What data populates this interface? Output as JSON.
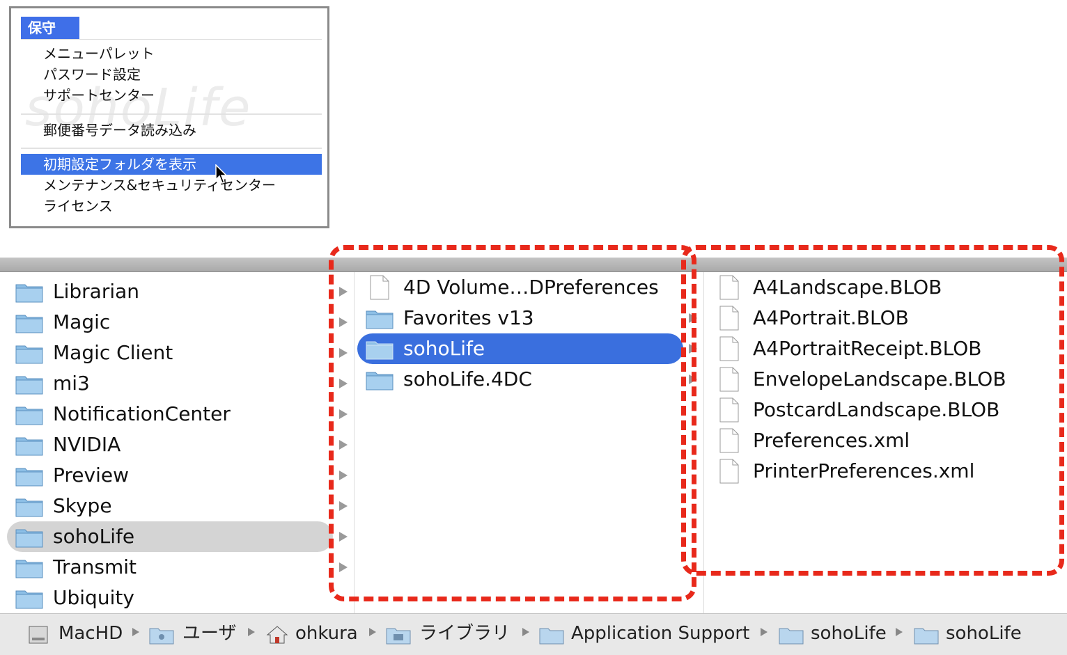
{
  "menu": {
    "title": "保守",
    "watermark": "sohoLife",
    "items": [
      {
        "label": "メニューパレット"
      },
      {
        "label": "パスワード設定"
      },
      {
        "label": "サポートセンター"
      },
      {
        "label": "郵便番号データ読み込み"
      },
      {
        "label": "初期設定フォルダを表示",
        "selected": true
      },
      {
        "label": "メンテナンス&セキュリティセンター"
      },
      {
        "label": "ライセンス"
      }
    ]
  },
  "finder": {
    "column1": [
      {
        "label": "Librarian",
        "kind": "folder"
      },
      {
        "label": "Magic",
        "kind": "folder"
      },
      {
        "label": "Magic Client",
        "kind": "folder"
      },
      {
        "label": "mi3",
        "kind": "folder"
      },
      {
        "label": "NotificationCenter",
        "kind": "folder"
      },
      {
        "label": "NVIDIA",
        "kind": "folder"
      },
      {
        "label": "Preview",
        "kind": "folder"
      },
      {
        "label": "Skype",
        "kind": "folder"
      },
      {
        "label": "sohoLife",
        "kind": "folder",
        "selected": true
      },
      {
        "label": "Transmit",
        "kind": "folder"
      },
      {
        "label": "Ubiquity",
        "kind": "folder"
      }
    ],
    "column2": [
      {
        "label": "4D Volume…DPreferences",
        "kind": "file"
      },
      {
        "label": "Favorites v13",
        "kind": "folder"
      },
      {
        "label": "sohoLife",
        "kind": "folder",
        "selected": true
      },
      {
        "label": "sohoLife.4DC",
        "kind": "folder"
      }
    ],
    "column3": [
      {
        "label": "A4Landscape.BLOB",
        "kind": "file"
      },
      {
        "label": "A4Portrait.BLOB",
        "kind": "file"
      },
      {
        "label": "A4PortraitReceipt.BLOB",
        "kind": "file"
      },
      {
        "label": "EnvelopeLandscape.BLOB",
        "kind": "file"
      },
      {
        "label": "PostcardLandscape.BLOB",
        "kind": "file"
      },
      {
        "label": "Preferences.xml",
        "kind": "file"
      },
      {
        "label": "PrinterPreferences.xml",
        "kind": "file"
      }
    ]
  },
  "pathbar": {
    "crumbs": [
      {
        "label": "MacHD",
        "icon": "hard-drive-icon"
      },
      {
        "label": "ユーザ",
        "icon": "users-folder-icon"
      },
      {
        "label": "ohkura",
        "icon": "home-icon"
      },
      {
        "label": "ライブラリ",
        "icon": "library-folder-icon"
      },
      {
        "label": "Application Support",
        "icon": "folder-icon"
      },
      {
        "label": "sohoLife",
        "icon": "folder-icon"
      },
      {
        "label": "sohoLife",
        "icon": "folder-icon"
      }
    ]
  },
  "colors": {
    "selection_blue": "#3a6fde",
    "menu_highlight": "#3d74e6",
    "annotation_red": "#e8291b",
    "folder_blue": "#8dbfe6"
  }
}
